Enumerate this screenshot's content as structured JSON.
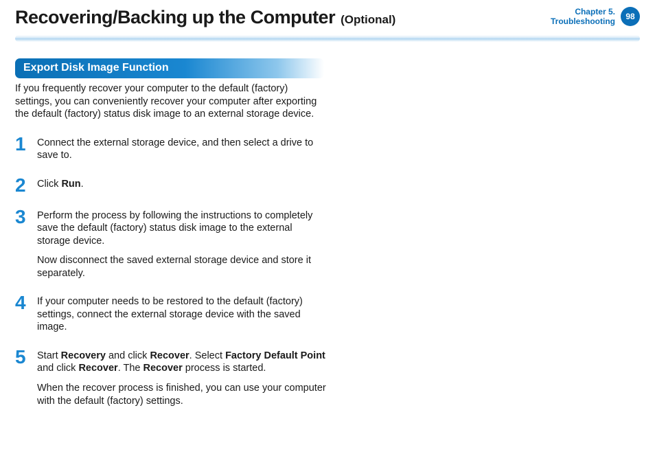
{
  "header": {
    "title": "Recovering/Backing up the Computer",
    "suffix": "(Optional)",
    "chapter_line1": "Chapter 5.",
    "chapter_line2": "Troubleshooting",
    "page_number": "98"
  },
  "section": {
    "heading": "Export Disk Image Function",
    "intro": "If you frequently recover your computer to the default (factory) settings, you can conveniently recover your computer after exporting the default (factory) status disk image to an external storage device."
  },
  "steps": {
    "s1": {
      "num": "1",
      "text": "Connect the external storage device, and then select a drive to save to."
    },
    "s2": {
      "num": "2",
      "prefix": "Click ",
      "bold": "Run",
      "suffix": "."
    },
    "s3": {
      "num": "3",
      "p1": "Perform the process by following the instructions to completely save the default (factory) status disk image to the external storage device.",
      "p2": "Now disconnect the saved external storage device and store it separately."
    },
    "s4": {
      "num": "4",
      "text": "If your computer needs to be restored to the default (factory) settings, connect the external storage device with the saved image."
    },
    "s5": {
      "num": "5",
      "p1_a": "Start ",
      "p1_b": "Recovery",
      "p1_c": " and click ",
      "p1_d": "Recover",
      "p1_e": ". Select ",
      "p1_f": "Factory Default Point",
      "p1_g": " and click ",
      "p1_h": "Recover",
      "p1_i": ". The ",
      "p1_j": "Recover",
      "p1_k": " process is started.",
      "p2": "When the recover process is finished, you can use your computer with the default (factory) settings."
    }
  }
}
